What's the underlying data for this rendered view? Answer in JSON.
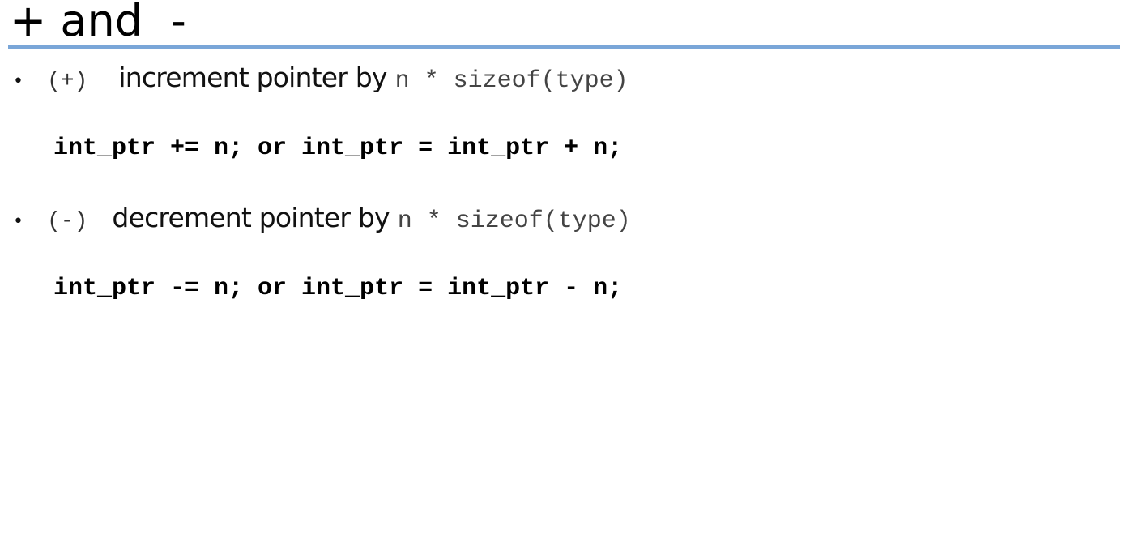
{
  "title": "+ and  -",
  "items": [
    {
      "operator": "(+)",
      "description": "increment pointer by",
      "formula": "n * sizeof(type)",
      "code": "int_ptr += n; or int_ptr = int_ptr + n;"
    },
    {
      "operator": "(-)",
      "description": "decrement pointer by",
      "formula": "n * sizeof(type)",
      "code": "int_ptr -= n; or int_ptr = int_ptr - n;"
    }
  ],
  "colors": {
    "rule": "#7aa6d8",
    "text": "#111111",
    "formula": "#444444"
  }
}
